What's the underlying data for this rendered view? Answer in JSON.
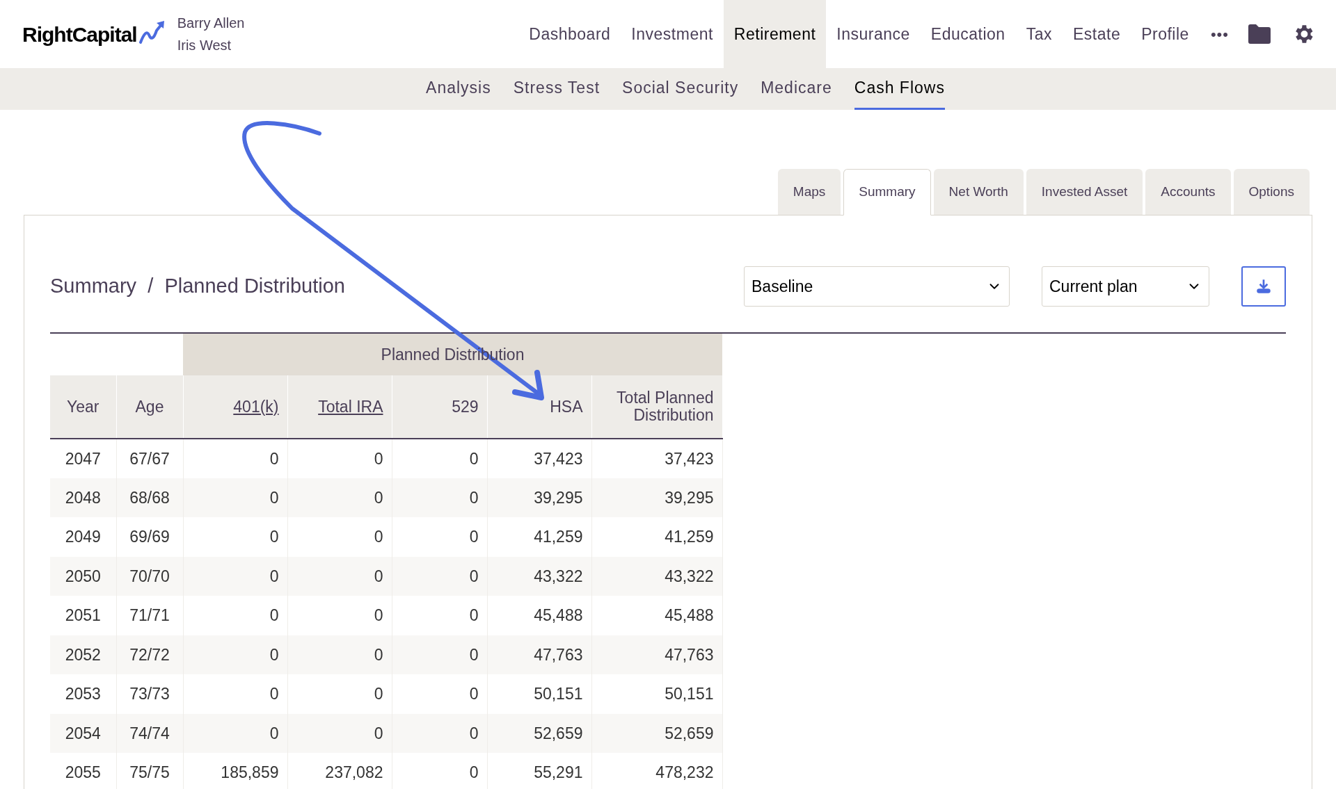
{
  "header": {
    "logo": "RightCapital",
    "clients": [
      "Barry Allen",
      "Iris West"
    ],
    "nav": [
      {
        "label": "Dashboard",
        "selected": false
      },
      {
        "label": "Investment",
        "selected": false
      },
      {
        "label": "Retirement",
        "selected": true
      },
      {
        "label": "Insurance",
        "selected": false
      },
      {
        "label": "Education",
        "selected": false
      },
      {
        "label": "Tax",
        "selected": false
      },
      {
        "label": "Estate",
        "selected": false
      },
      {
        "label": "Profile",
        "selected": false
      }
    ],
    "more": "•••"
  },
  "subnav": [
    {
      "label": "Analysis",
      "selected": false
    },
    {
      "label": "Stress Test",
      "selected": false
    },
    {
      "label": "Social Security",
      "selected": false
    },
    {
      "label": "Medicare",
      "selected": false
    },
    {
      "label": "Cash Flows",
      "selected": true
    }
  ],
  "tabs": [
    {
      "label": "Maps",
      "selected": false
    },
    {
      "label": "Summary",
      "selected": true
    },
    {
      "label": "Net Worth",
      "selected": false
    },
    {
      "label": "Invested Asset",
      "selected": false
    },
    {
      "label": "Accounts",
      "selected": false
    },
    {
      "label": "Options",
      "selected": false
    }
  ],
  "breadcrumb": [
    "Summary",
    "Planned Distribution"
  ],
  "breadcrumb_separator": "/",
  "selects": [
    "Baseline",
    "Current plan"
  ],
  "table": {
    "group_header": "Planned Distribution",
    "columns": [
      {
        "label": "Year",
        "link": false
      },
      {
        "label": "Age",
        "link": false
      },
      {
        "label": "401(k)",
        "link": true
      },
      {
        "label": "Total IRA",
        "link": true
      },
      {
        "label": "529",
        "link": false
      },
      {
        "label": "HSA",
        "link": false
      },
      {
        "label": "Total Planned Distribution",
        "link": false
      }
    ],
    "rows": [
      [
        "2047",
        "67/67",
        "0",
        "0",
        "0",
        "37,423",
        "37,423"
      ],
      [
        "2048",
        "68/68",
        "0",
        "0",
        "0",
        "39,295",
        "39,295"
      ],
      [
        "2049",
        "69/69",
        "0",
        "0",
        "0",
        "41,259",
        "41,259"
      ],
      [
        "2050",
        "70/70",
        "0",
        "0",
        "0",
        "43,322",
        "43,322"
      ],
      [
        "2051",
        "71/71",
        "0",
        "0",
        "0",
        "45,488",
        "45,488"
      ],
      [
        "2052",
        "72/72",
        "0",
        "0",
        "0",
        "47,763",
        "47,763"
      ],
      [
        "2053",
        "73/73",
        "0",
        "0",
        "0",
        "50,151",
        "50,151"
      ],
      [
        "2054",
        "74/74",
        "0",
        "0",
        "0",
        "52,659",
        "52,659"
      ],
      [
        "2055",
        "75/75",
        "185,859",
        "237,082",
        "0",
        "55,291",
        "478,232"
      ]
    ]
  }
}
